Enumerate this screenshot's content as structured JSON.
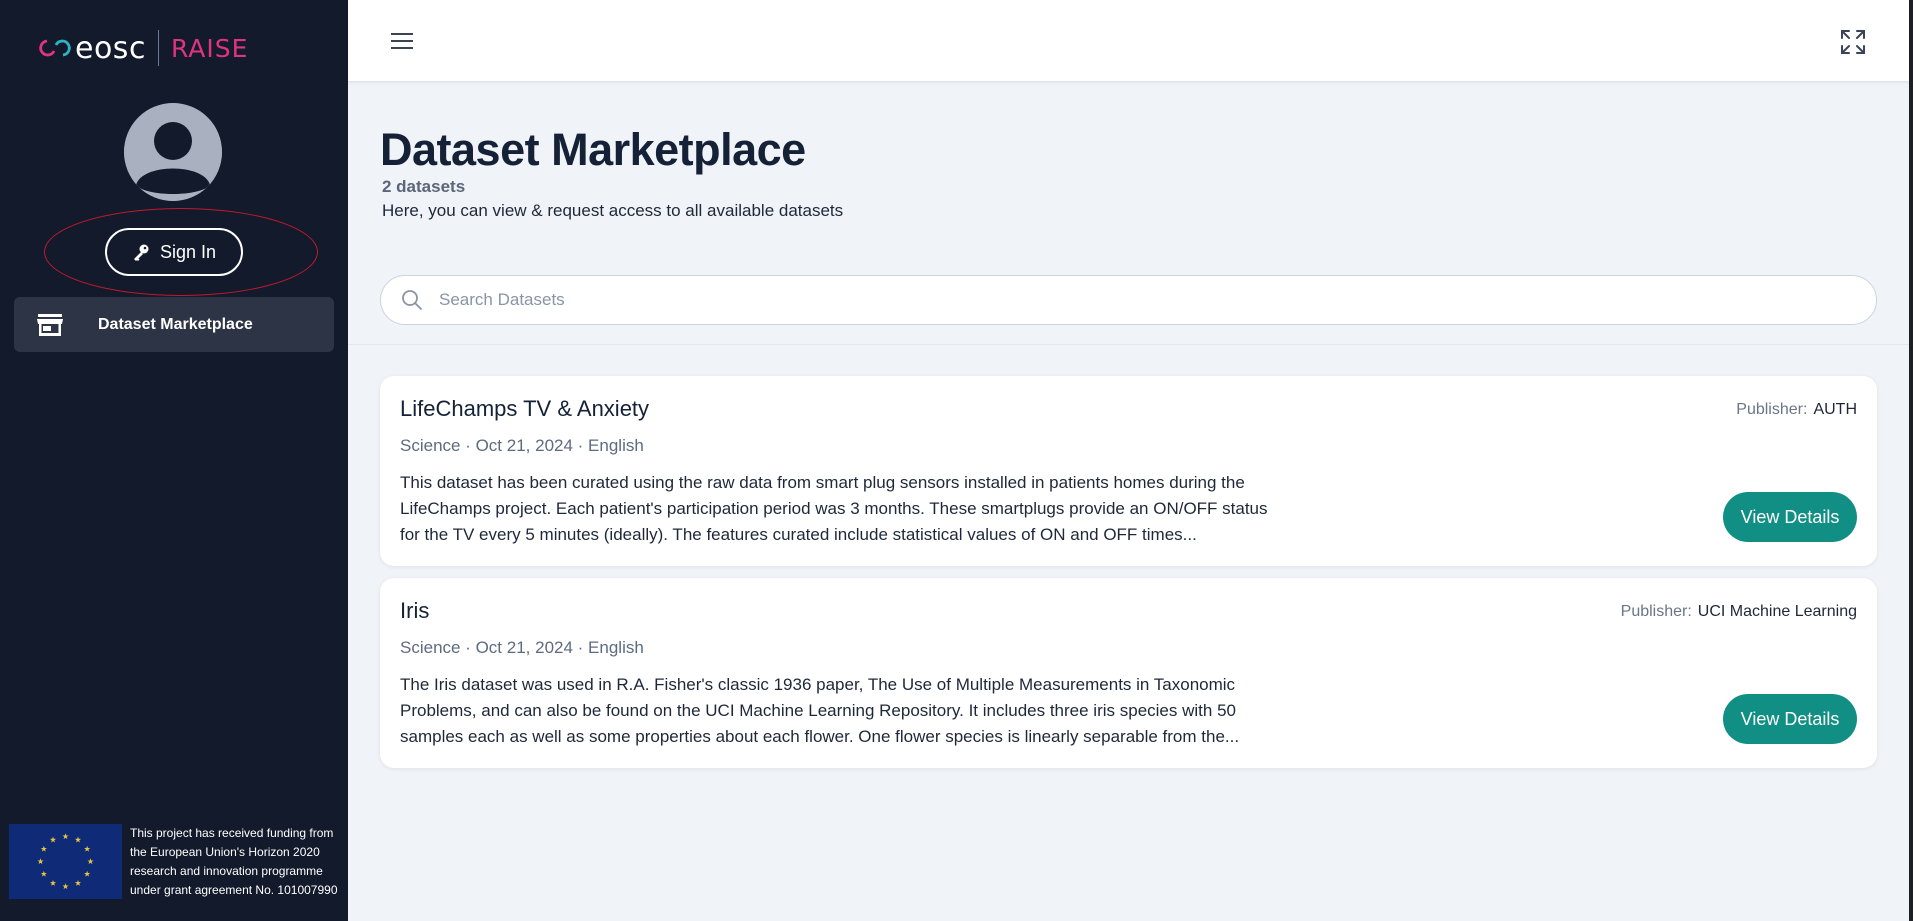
{
  "brand": {
    "name": "eosc",
    "sub": "RAISE"
  },
  "sidebar": {
    "sign_in_label": "Sign In",
    "nav_items": [
      {
        "label": "Dataset Marketplace"
      }
    ],
    "funding_text": "This project has received funding from the European Union's Horizon 2020 research and innovation programme under grant agreement No. 101007990"
  },
  "main": {
    "title": "Dataset Marketplace",
    "count": "2 datasets",
    "subtitle": "Here, you can view & request access to all available datasets",
    "search": {
      "placeholder": "Search Datasets",
      "value": ""
    },
    "publisher_label": "Publisher:",
    "details_label": "View Details",
    "datasets": [
      {
        "title": "LifeChamps TV & Anxiety",
        "meta": "Science · Oct 21, 2024 · English",
        "description": "This dataset has been curated using the raw data from smart plug sensors installed in patients homes during the LifeChamps project. Each patient's participation period was 3 months. These smartplugs provide an ON/OFF status for the TV every 5 minutes (ideally). The features curated include statistical values of ON and OFF times...",
        "publisher": "AUTH"
      },
      {
        "title": "Iris",
        "meta": "Science · Oct 21, 2024 · English",
        "description": "The Iris dataset was used in R.A. Fisher's classic 1936 paper, The Use of Multiple Measurements in Taxonomic Problems, and can also be found on the UCI Machine Learning Repository. It includes three iris species with 50 samples each as well as some properties about each flower. One flower species is linearly separable from the...",
        "publisher": "UCI Machine Learning"
      }
    ]
  },
  "icons": {
    "menu": "hamburger-icon",
    "fullscreen": "expand-icon",
    "search": "search-icon",
    "sign_in": "key-icon",
    "nav": "store-icon",
    "avatar": "user-icon",
    "flag": "eu-flag-icon"
  },
  "colors": {
    "sidebar_bg": "#121a2c",
    "nav_active_bg": "#2c3445",
    "accent_teal": "#128f84",
    "highlight_red": "#c41a2a",
    "page_bg": "#f0f3f7"
  }
}
